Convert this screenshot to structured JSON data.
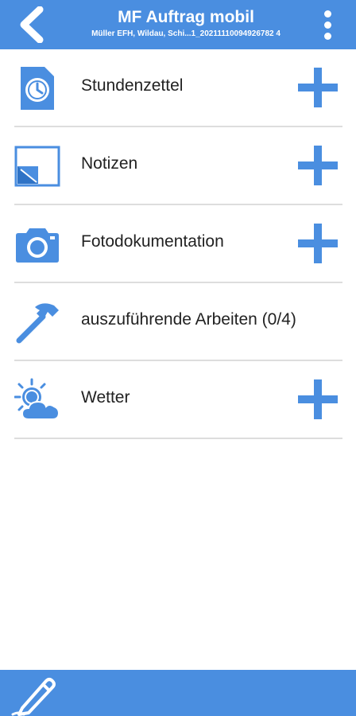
{
  "header": {
    "title": "MF Auftrag mobil",
    "subtitle": "Müller EFH, Wildau, Schi...1_20211110094926782 4",
    "back_icon": "chevron-left-icon",
    "menu_icon": "more-vertical-icon"
  },
  "list": {
    "items": [
      {
        "label": "Stundenzettel",
        "icon": "timesheet-clock-icon",
        "has_add": true
      },
      {
        "label": "Notizen",
        "icon": "note-icon",
        "has_add": true
      },
      {
        "label": "Fotodokumentation",
        "icon": "camera-icon",
        "has_add": true
      },
      {
        "label": "auszuführende Arbeiten (0/4)",
        "icon": "hammer-icon",
        "has_add": false
      },
      {
        "label": "Wetter",
        "icon": "weather-icon",
        "has_add": true
      }
    ]
  },
  "footer": {
    "icon": "pen-icon"
  },
  "colors": {
    "accent": "#4a8ee0",
    "text": "#222222",
    "divider": "#dddddd"
  }
}
